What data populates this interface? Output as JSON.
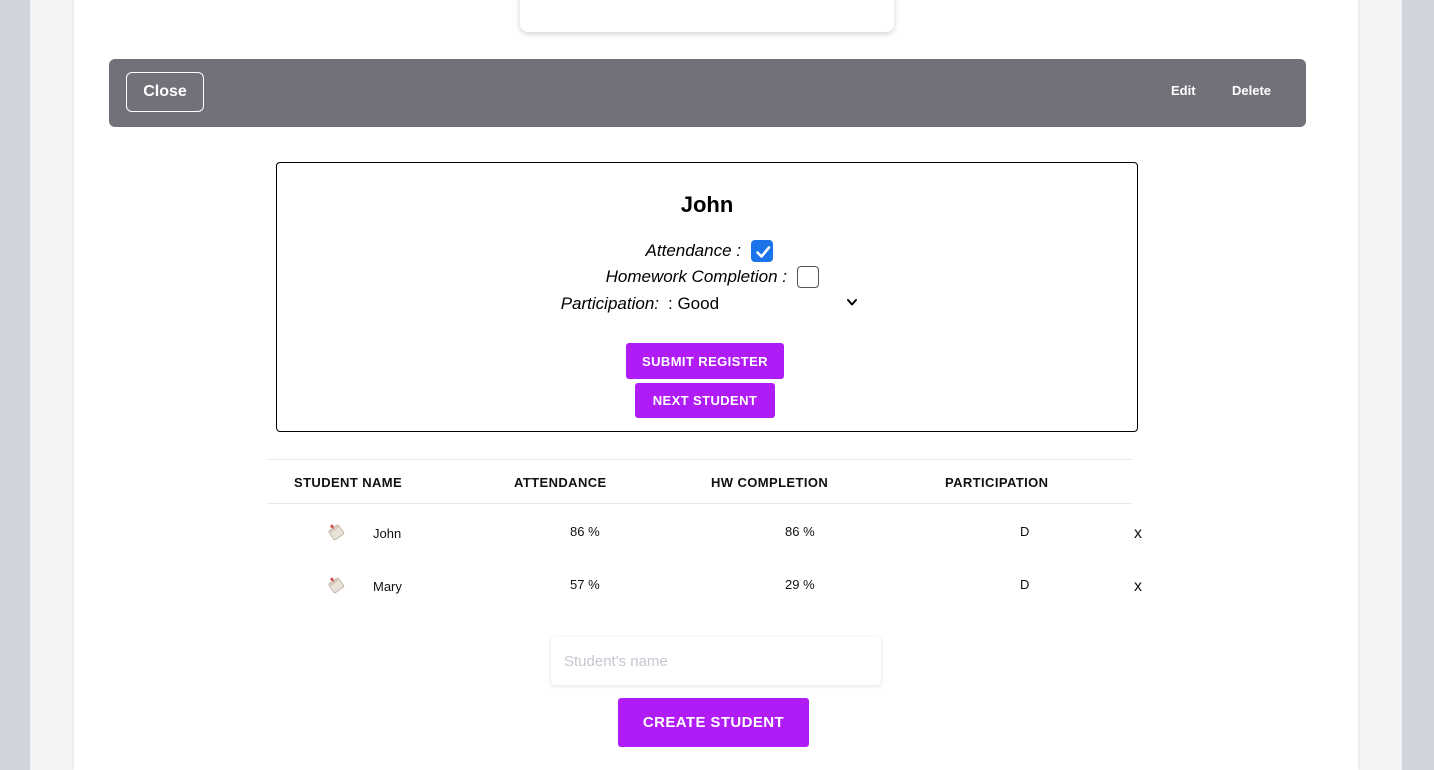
{
  "toolbar": {
    "close_label": "Close",
    "edit_label": "Edit",
    "delete_label": "Delete"
  },
  "register": {
    "student_name": "John",
    "attendance_label": "Attendance :",
    "attendance_checked": true,
    "homework_label": "Homework Completion :",
    "homework_checked": false,
    "participation_label": "Participation:",
    "participation_value": ": Good",
    "submit_label": "SUBMIT REGISTER",
    "next_label": "NEXT STUDENT"
  },
  "table": {
    "headers": [
      "STUDENT NAME",
      "ATTENDANCE",
      "HW COMPLETION",
      "PARTICIPATION"
    ],
    "rows": [
      {
        "name": "John",
        "attendance": "86 %",
        "hw": "86 %",
        "participation": "D",
        "remove": "x"
      },
      {
        "name": "Mary",
        "attendance": "57 %",
        "hw": "29 %",
        "participation": "D",
        "remove": "x"
      }
    ]
  },
  "create": {
    "placeholder": "Student's name",
    "button_label": "CREATE STUDENT"
  },
  "colors": {
    "accent": "#b01cf5",
    "toolbar": "#71717a",
    "checkbox": "#1a73e8"
  }
}
